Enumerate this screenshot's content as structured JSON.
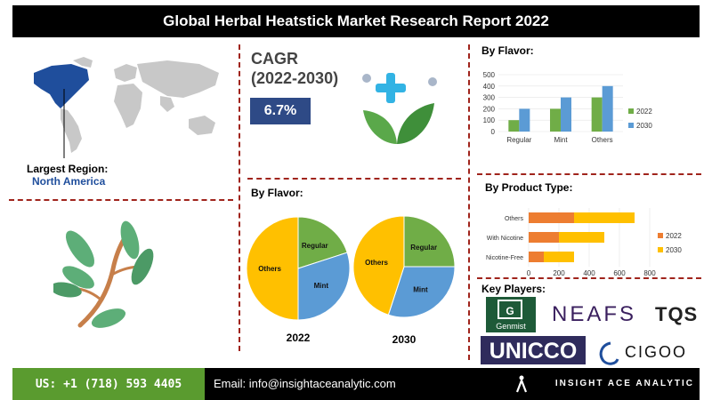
{
  "header": {
    "title": "Global Herbal Heatstick Market Research Report 2022"
  },
  "region": {
    "label": "Largest Region:",
    "value": "North America"
  },
  "cagr": {
    "title_line1": "CAGR",
    "title_line2": "(2022-2030)",
    "value": "6.7%"
  },
  "flavor_pies": {
    "title": "By Flavor:",
    "labels": {
      "regular": "Regular",
      "mint": "Mint",
      "others": "Others"
    }
  },
  "right": {
    "flavor_title": "By Flavor:",
    "product_title": "By Product Type:",
    "players_title": "Key Players:"
  },
  "players": {
    "genmist": "Genmist",
    "neafs": "NEAFS",
    "tqs": "TQS",
    "unicco": "UNICCO",
    "cigoo": "CIGOO"
  },
  "footer": {
    "phone": "US: +1 (718) 593 4405",
    "email": "Email: info@insightaceanalytic.com",
    "brand": "INSIGHT ACE ANALYTIC"
  },
  "colors": {
    "series_2022_flavor": "#70ad47",
    "series_2030_flavor": "#5b9bd5",
    "series_2022_product": "#ed7d31",
    "series_2030_product": "#ffc000",
    "pie_regular": "#70ad47",
    "pie_mint": "#5b9bd5",
    "pie_others": "#ffc000",
    "accent": "#a0241c",
    "cagr_box": "#2e4a86"
  },
  "chart_data": [
    {
      "type": "bar",
      "title": "By Flavor:",
      "categories": [
        "Regular",
        "Mint",
        "Others"
      ],
      "series": [
        {
          "name": "2022",
          "values": [
            100,
            200,
            300
          ]
        },
        {
          "name": "2030",
          "values": [
            200,
            300,
            400
          ]
        }
      ],
      "ylim": [
        0,
        500
      ],
      "yticks": [
        "0",
        "100",
        "200",
        "300",
        "400",
        "500"
      ],
      "legend": "right"
    },
    {
      "type": "bar",
      "orientation": "horizontal",
      "stacked": true,
      "title": "By Product Type:",
      "categories": [
        "Others",
        "With Nicotine",
        "Nicotine-Free"
      ],
      "series": [
        {
          "name": "2022",
          "values": [
            300,
            200,
            100
          ]
        },
        {
          "name": "2030",
          "values": [
            400,
            300,
            200
          ]
        }
      ],
      "xlim": [
        0,
        800
      ],
      "xticks": [
        "0",
        "200",
        "400",
        "600",
        "800"
      ],
      "legend": "right"
    },
    {
      "type": "pie",
      "title": "2022",
      "slices": [
        {
          "name": "Regular",
          "value": 20
        },
        {
          "name": "Mint",
          "value": 30
        },
        {
          "name": "Others",
          "value": 50
        }
      ]
    },
    {
      "type": "pie",
      "title": "2030",
      "slices": [
        {
          "name": "Regular",
          "value": 25
        },
        {
          "name": "Mint",
          "value": 30
        },
        {
          "name": "Others",
          "value": 45
        }
      ]
    }
  ]
}
